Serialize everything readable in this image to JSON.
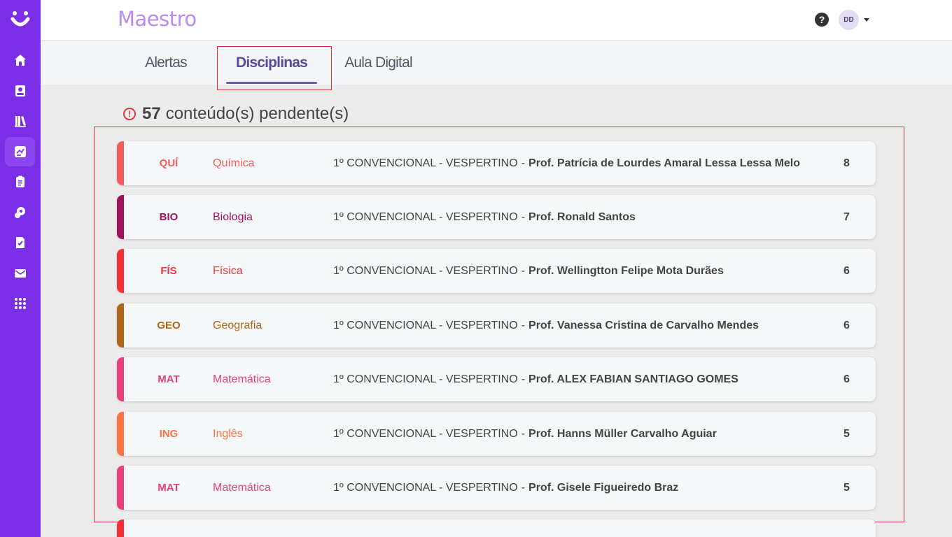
{
  "app": {
    "title": "Maestro"
  },
  "header": {
    "help_glyph": "?",
    "avatar_initials": "DD"
  },
  "sidebar": {
    "icons": [
      "home-icon",
      "student-icon",
      "library-icon",
      "classes-icon",
      "clipboard-icon",
      "support-icon",
      "assignment-icon",
      "mail-icon",
      "apps-icon"
    ],
    "active_index": 3
  },
  "tabs": [
    {
      "label": "Alertas",
      "active": false
    },
    {
      "label": "Disciplinas",
      "active": true
    },
    {
      "label": "Aula Digital",
      "active": false
    }
  ],
  "pending": {
    "count": "57",
    "label": "conteúdo(s) pendente(s)",
    "icon_glyph": "!"
  },
  "rows": [
    {
      "abbr": "QUÍ",
      "subject": "Química",
      "group": "1º CONVENCIONAL - VESPERTINO",
      "separator": "-",
      "teacher": "Prof. Patrícia de Lourdes Amaral Lessa Lessa Melo",
      "count": "8",
      "color": "#f55b5b"
    },
    {
      "abbr": "BIO",
      "subject": "Biologia",
      "group": "1º CONVENCIONAL - VESPERTINO",
      "separator": "-",
      "teacher": "Prof. Ronald Santos",
      "count": "7",
      "color": "#a1125e"
    },
    {
      "abbr": "FÍS",
      "subject": "Física",
      "group": "1º CONVENCIONAL - VESPERTINO",
      "separator": "-",
      "teacher": "Prof. Wellingtton Felipe Mota Durães",
      "count": "6",
      "color": "#f23138"
    },
    {
      "abbr": "GEO",
      "subject": "Geografia",
      "group": "1º CONVENCIONAL - VESPERTINO",
      "separator": "-",
      "teacher": "Prof. Vanessa Cristina de Carvalho Mendes",
      "count": "6",
      "color": "#b0651b"
    },
    {
      "abbr": "MAT",
      "subject": "Matemática",
      "group": "1º CONVENCIONAL - VESPERTINO",
      "separator": "-",
      "teacher": "Prof. ALEX FABIAN SANTIAGO GOMES",
      "count": "6",
      "color": "#e83e7c"
    },
    {
      "abbr": "ING",
      "subject": "Inglês",
      "group": "1º CONVENCIONAL - VESPERTINO",
      "separator": "-",
      "teacher": "Prof. Hanns Müller Carvalho Aguiar",
      "count": "5",
      "color": "#ff7440"
    },
    {
      "abbr": "MAT",
      "subject": "Matemática",
      "group": "1º CONVENCIONAL - VESPERTINO",
      "separator": "-",
      "teacher": "Prof. Gisele Figueiredo Braz",
      "count": "5",
      "color": "#e83e7c"
    },
    {
      "abbr": "",
      "subject": "",
      "group": "",
      "separator": "",
      "teacher": "",
      "count": "",
      "color": "#f23138"
    }
  ]
}
